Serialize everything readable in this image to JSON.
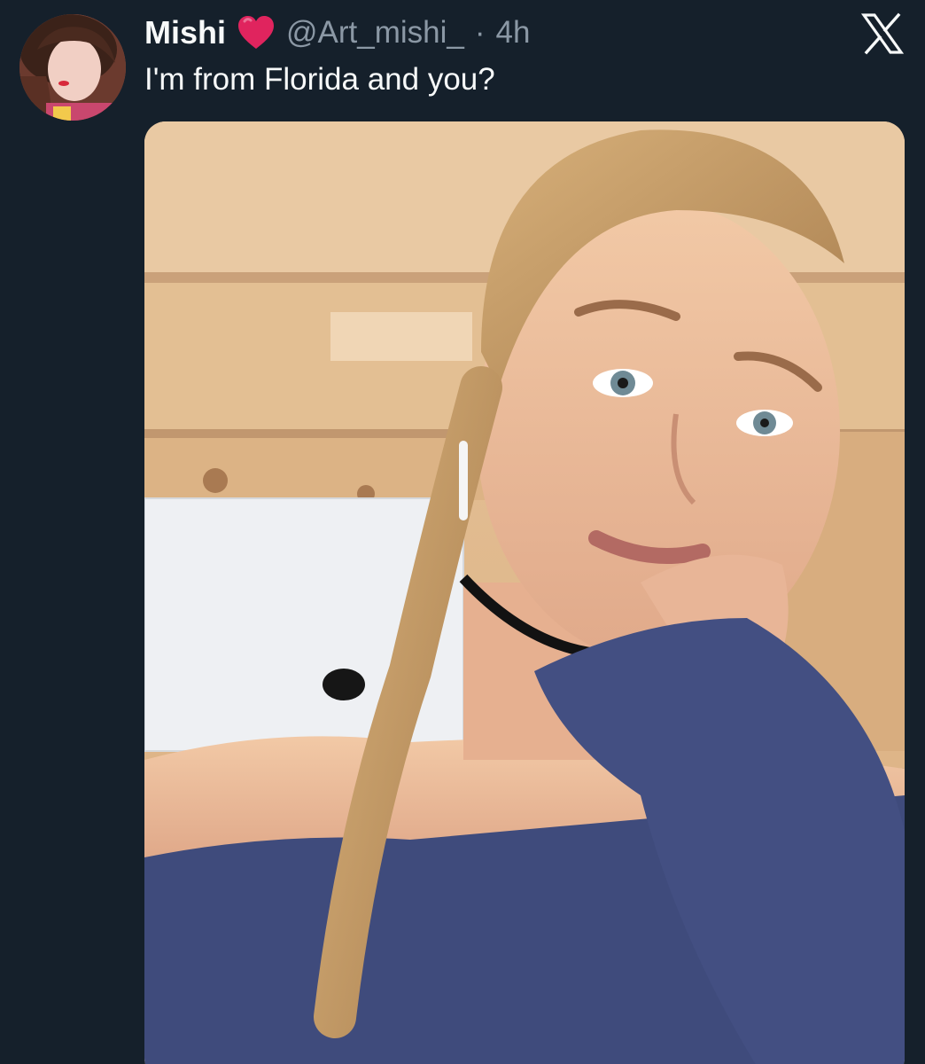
{
  "tweet": {
    "author": {
      "display_name": "Mishi",
      "badge_icon": "red-heart-icon",
      "handle": "@Art_mishi_",
      "avatar_icon": "profile-avatar"
    },
    "separator": "·",
    "time": "4h",
    "text": "I'm from Florida and you?",
    "media": {
      "kind": "photo",
      "icon": "photo-image"
    }
  },
  "brand": {
    "logo_icon": "x-logo-icon"
  },
  "colors": {
    "background": "#15202b",
    "primary_text": "#f7f9f9",
    "secondary_text": "#8b98a5",
    "heart": "#e0245e"
  }
}
